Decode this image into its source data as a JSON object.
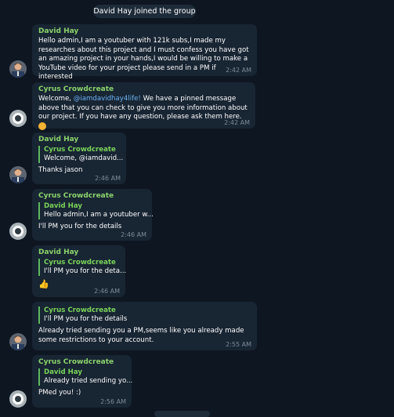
{
  "service_message": "David Hay joined the group",
  "messages": [
    {
      "sender": "David Hay",
      "text": "Hello admin,I am a youtuber with 121k subs,I made my researches about this project and I must confess you have got an amazing project in your hands,I would be willing to make a YouTube video for your project please send in a PM if interested",
      "time": "2:42 AM"
    },
    {
      "sender": "Cyrus Crowdcreate",
      "text_before": "Welcome, ",
      "mention": "@iamdavidhay4life!",
      "text_after": " We have a pinned message above that you can check to give you more information about our project. If you have any question, please ask them here.",
      "time": "2:42 AM"
    },
    {
      "sender": "David Hay",
      "reply_name": "Cyrus Crowdcreate",
      "reply_text": "Welcome, @iamdavid...",
      "text": "Thanks jason",
      "time": "2:46 AM"
    },
    {
      "sender": "Cyrus Crowdcreate",
      "reply_name": "David Hay",
      "reply_text": "Hello admin,I am a youtuber w...",
      "text": "I'll PM you for the details",
      "time": "2:46 AM"
    },
    {
      "sender": "David Hay",
      "reply_name": "Cyrus Crowdcreate",
      "reply_text": "I'll PM you for the deta...",
      "text": "👍",
      "time": "2:46 AM"
    },
    {
      "reply_name": "Cyrus Crowdcreate",
      "reply_text": "I'll PM you for the details",
      "text": "Already tried sending you a PM,seems like you already made some restrictions to your account.",
      "time": "2:55 AM"
    },
    {
      "sender": "Cyrus Crowdcreate",
      "reply_name": "David Hay",
      "reply_text": "Already tried sending yo...",
      "text": "PMed you! :)",
      "time": "2:56 AM"
    }
  ],
  "colors": {
    "background": "#0e1621",
    "bubble": "#182533",
    "sender_green": "#8bd36b",
    "link_blue": "#6ab3f3",
    "time_gray": "#7d8b99"
  },
  "icons": {
    "david_avatar": "user-photo-icon",
    "cyrus_avatar": "logo-avatar-icon"
  }
}
